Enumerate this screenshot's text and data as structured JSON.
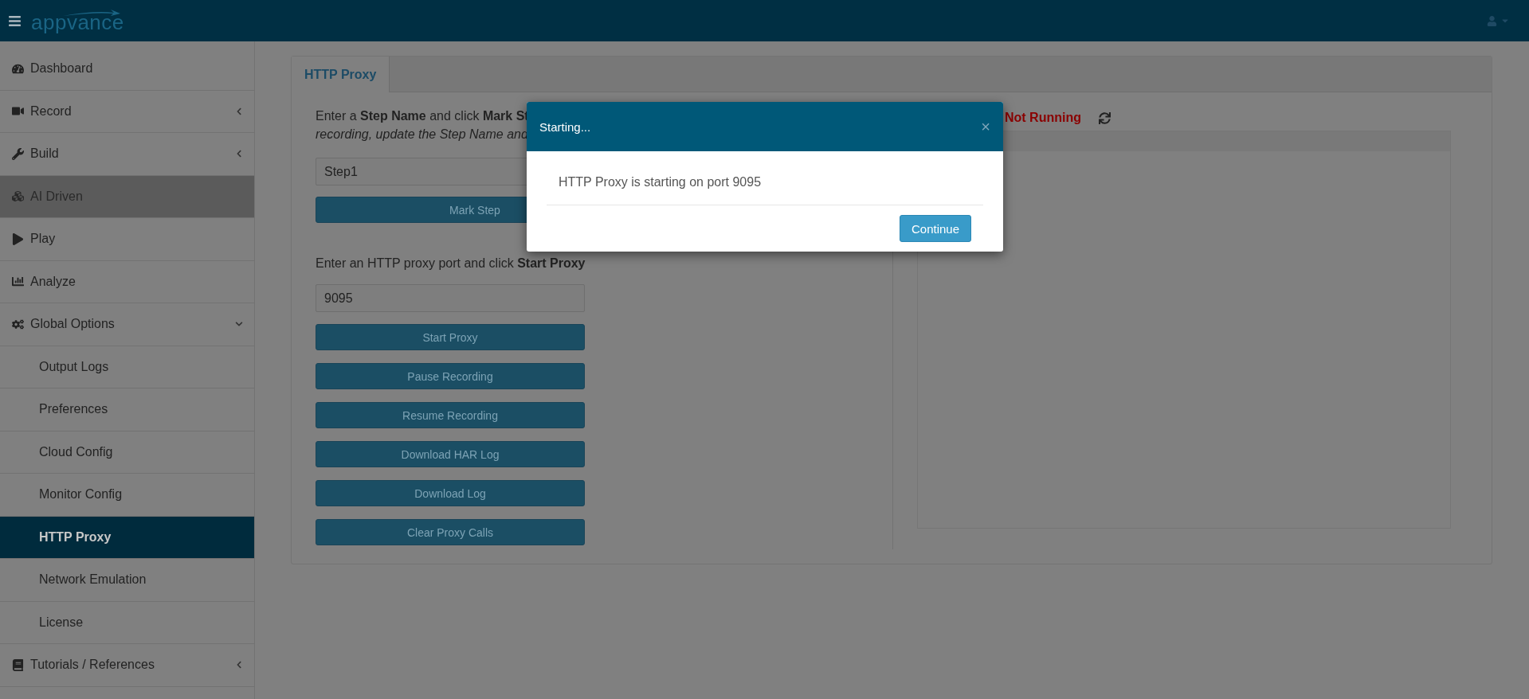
{
  "topbar": {
    "logo": "appvance"
  },
  "sidebar": {
    "items": [
      {
        "label": "Dashboard",
        "selected": false,
        "disabled": false
      },
      {
        "label": "Record",
        "selected": false,
        "disabled": false,
        "expanded": false
      },
      {
        "label": "Build",
        "selected": false,
        "disabled": false,
        "expanded": false
      },
      {
        "label": "AI Driven",
        "selected": false,
        "disabled": true
      },
      {
        "label": "Play",
        "selected": false,
        "disabled": false
      },
      {
        "label": "Analyze",
        "selected": false,
        "disabled": false
      },
      {
        "label": "Global Options",
        "selected": false,
        "disabled": false,
        "expanded": true,
        "children": [
          {
            "label": "Output Logs",
            "selected": false
          },
          {
            "label": "Preferences",
            "selected": false
          },
          {
            "label": "Cloud Config",
            "selected": false
          },
          {
            "label": "Monitor Config",
            "selected": false
          },
          {
            "label": "HTTP Proxy",
            "selected": true
          },
          {
            "label": "Network Emulation",
            "selected": false
          },
          {
            "label": "License",
            "selected": false
          }
        ]
      },
      {
        "label": "Tutorials / References",
        "selected": false,
        "disabled": false,
        "expanded": false
      }
    ]
  },
  "tabs": [
    {
      "label": "HTTP Proxy",
      "selected": true
    }
  ],
  "step_section": {
    "text": "Enter a **Step Name** and click **Mark St**",
    "note": "recording, update the Step Name and",
    "step_name": "Step1",
    "button": "Mark Step"
  },
  "proxy_section": {
    "text": "Enter an HTTP proxy port and click **Start Proxy**",
    "port": "9095",
    "buttons": [
      "Start Proxy",
      "Pause Recording",
      "Resume Recording",
      "Download HAR Log",
      "Download Log",
      "Clear Proxy Calls"
    ]
  },
  "status": {
    "value": "Not Running"
  },
  "modal": {
    "title": "Starting...",
    "close": "×",
    "message": "HTTP Proxy is starting on port 9095",
    "button": "Continue"
  }
}
